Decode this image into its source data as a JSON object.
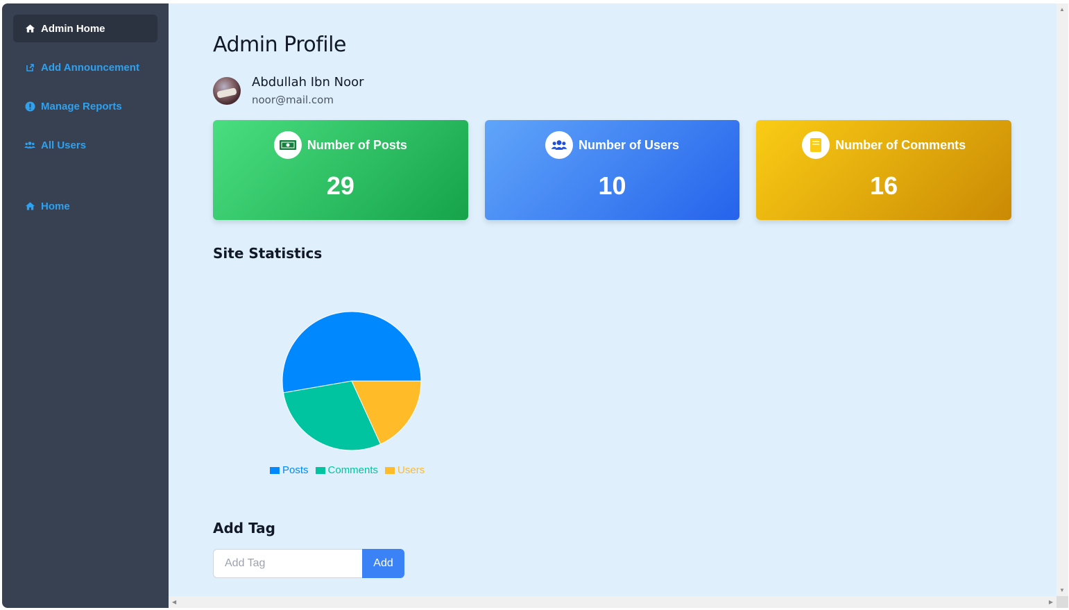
{
  "sidebar": {
    "items": [
      {
        "label": "Admin Home",
        "icon": "home-icon"
      },
      {
        "label": "Add Announcement",
        "icon": "external-link-icon"
      },
      {
        "label": "Manage Reports",
        "icon": "alert-circle-icon"
      },
      {
        "label": "All Users",
        "icon": "users-icon"
      },
      {
        "label": "Home",
        "icon": "home-icon"
      }
    ]
  },
  "main": {
    "title": "Admin Profile",
    "profile": {
      "name": "Abdullah Ibn Noor",
      "email": "noor@mail.com"
    },
    "cards": [
      {
        "label": "Number of Posts",
        "value": "29",
        "icon": "money-icon"
      },
      {
        "label": "Number of Users",
        "value": "10",
        "icon": "users-icon"
      },
      {
        "label": "Number of Comments",
        "value": "16",
        "icon": "book-icon"
      }
    ],
    "stats_title": "Site Statistics",
    "tag": {
      "title": "Add Tag",
      "placeholder": "Add Tag",
      "button": "Add"
    }
  },
  "colors": {
    "sidebar_bg": "#374151",
    "main_bg": "#dfeffc",
    "link": "#2ea1f0",
    "posts": "#0088fe",
    "comments": "#00c49f",
    "users": "#ffbb28"
  },
  "chart_data": {
    "type": "pie",
    "categories": [
      "Posts",
      "Comments",
      "Users"
    ],
    "values": [
      29,
      16,
      10
    ],
    "legend": "bottom"
  }
}
